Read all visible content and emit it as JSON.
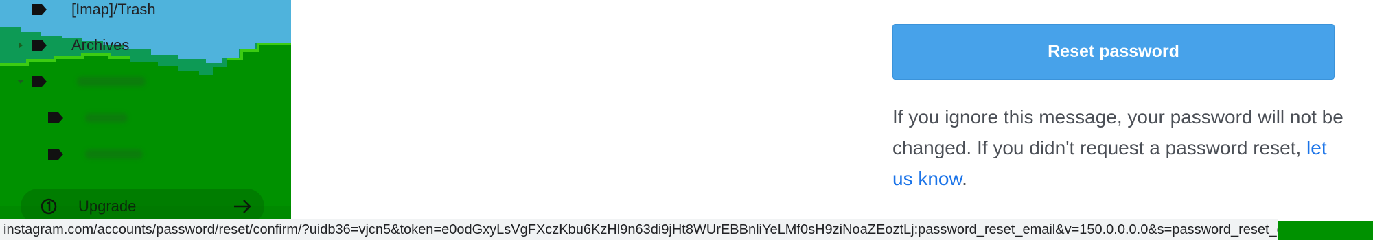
{
  "sidebar": {
    "folders": [
      {
        "label": "[Imap]/Trash",
        "icon": "label-tag-icon"
      },
      {
        "label": "Archives",
        "icon": "label-tag-icon",
        "expand_icon": "caret-right-icon"
      },
      {
        "label": "",
        "icon": "label-tag-icon",
        "expand_icon": "caret-down-icon",
        "redacted": true
      },
      {
        "label": "",
        "icon": "label-tag-icon",
        "redacted": true
      },
      {
        "label": "",
        "icon": "label-tag-icon",
        "redacted": true
      }
    ],
    "upgrade": {
      "label": "Upgrade",
      "icon": "upgrade-circle-icon",
      "arrow_icon": "arrow-right-icon"
    }
  },
  "email": {
    "reset_button_label": "Reset password",
    "notice_text": "If you ignore this message, your password will not be changed. If you didn't request a password reset,",
    "notice_link": "let us know",
    "notice_end": "."
  },
  "statusbar": {
    "url": "instagram.com/accounts/password/reset/confirm/?uidb36=vjcn5&token=e0odGxyLsVgFXczKbu6KzHl9n63di9jHt8WUrEBBnliYeLMf0sH9ziNoaZEoztLj:password_reset_email&v=150.0.0.0.0&s=password_reset_email"
  },
  "colors": {
    "button": "#47a2ea",
    "link": "#1a73e8",
    "sky": "#4fb3dc",
    "grass": "#009100",
    "hill": "#0d9a55"
  }
}
